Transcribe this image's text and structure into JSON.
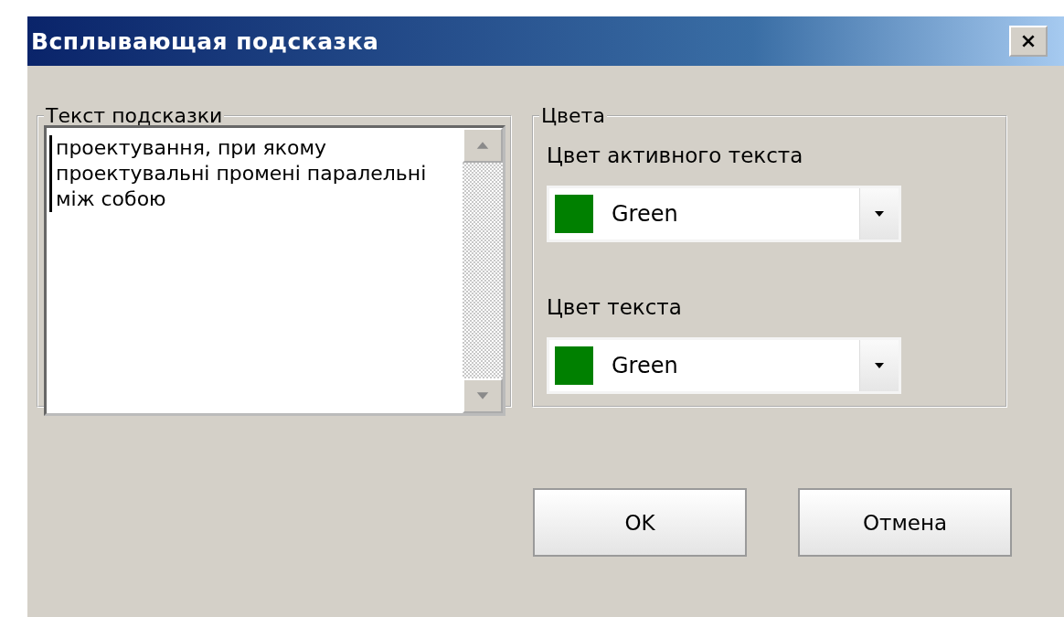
{
  "window": {
    "title": "Всплывающая подсказка"
  },
  "hint_group": {
    "title": "Текст подсказки",
    "text": "проектування, при якому проектувальні промені паралельні між собою"
  },
  "colors_group": {
    "title": "Цвета",
    "fields": [
      {
        "label": "Цвет активного текста",
        "value": "Green",
        "color": "#008000"
      },
      {
        "label": "Цвет текста",
        "value": "Green",
        "color": "#008000"
      }
    ]
  },
  "buttons": [
    {
      "label": "OK"
    },
    {
      "label": "Отмена"
    }
  ]
}
